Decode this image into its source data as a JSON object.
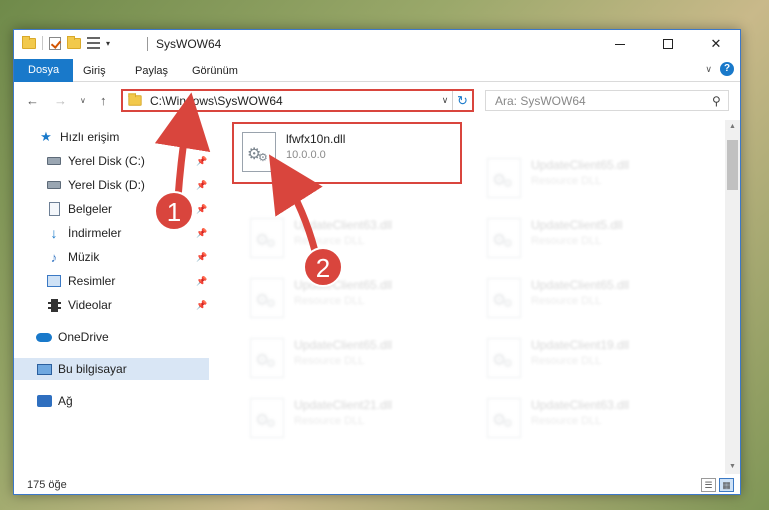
{
  "window": {
    "title": "SysWOW64",
    "minimize_glyph": "",
    "close_glyph": "✕"
  },
  "ribbon": {
    "tabs": [
      "Dosya",
      "Giriş",
      "Paylaş",
      "Görünüm"
    ],
    "expand_glyph": "∨",
    "help_glyph": "?"
  },
  "nav": {
    "back_glyph": "←",
    "forward_glyph": "→",
    "recent_glyph": "∨",
    "up_glyph": "↑",
    "address": "C:\\Windows\\SysWOW64",
    "address_caret": "∨",
    "refresh_glyph": "↻",
    "search_placeholder": "Ara: SysWOW64",
    "search_glyph": "⚲"
  },
  "sidebar": {
    "items": [
      {
        "label": "Hızlı erişim",
        "icon": "star-icon"
      },
      {
        "label": "Yerel Disk (C:)",
        "icon": "disk-icon"
      },
      {
        "label": "Yerel Disk (D:)",
        "icon": "disk-icon"
      },
      {
        "label": "Belgeler",
        "icon": "documents-icon"
      },
      {
        "label": "İndirmeler",
        "icon": "downloads-icon"
      },
      {
        "label": "Müzik",
        "icon": "music-icon"
      },
      {
        "label": "Resimler",
        "icon": "pictures-icon"
      },
      {
        "label": "Videolar",
        "icon": "videos-icon"
      },
      {
        "label": "OneDrive",
        "icon": "onedrive-icon"
      },
      {
        "label": "Bu bilgisayar",
        "icon": "computer-icon"
      },
      {
        "label": "Ağ",
        "icon": "network-icon"
      }
    ],
    "pin_glyph": "📌"
  },
  "files": {
    "highlighted": {
      "name": "lfwfx10n.dll",
      "desc": "10.0.0.0"
    },
    "faded_col1": [
      {
        "name": "UpdateClient63.dll",
        "desc": "Resource DLL"
      },
      {
        "name": "UpdateClient65.dll",
        "desc": "Resource DLL"
      },
      {
        "name": "UpdateClient65.dll",
        "desc": "Resource DLL"
      },
      {
        "name": "UpdateClient21.dll",
        "desc": "Resource DLL"
      }
    ],
    "faded_col2": [
      {
        "name": "UpdateClient65.dll",
        "desc": "Resource DLL"
      },
      {
        "name": "UpdateClient5.dll",
        "desc": "Resource DLL"
      },
      {
        "name": "UpdateClient65.dll",
        "desc": "Resource DLL"
      },
      {
        "name": "UpdateClient19.dll",
        "desc": "Resource DLL"
      },
      {
        "name": "UpdateClient63.dll",
        "desc": "Resource DLL"
      }
    ]
  },
  "scroll": {
    "up_glyph": "▲",
    "down_glyph": "▼"
  },
  "status": {
    "count": "175 öğe",
    "details_view_glyph": "☰",
    "tiles_view_glyph": "▦"
  },
  "annotations": {
    "step1": "1",
    "step2": "2",
    "color": "#d9453d"
  }
}
